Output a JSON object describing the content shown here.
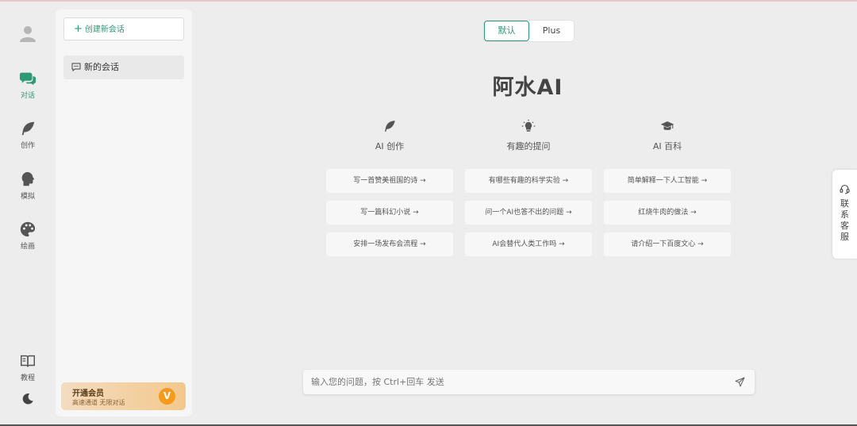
{
  "nav": {
    "items": [
      {
        "label": "对话",
        "icon": "chat-icon",
        "active": true
      },
      {
        "label": "创作",
        "icon": "feather-icon"
      },
      {
        "label": "模拟",
        "icon": "head-icon"
      },
      {
        "label": "绘画",
        "icon": "palette-icon"
      }
    ],
    "tutorial": {
      "label": "教程",
      "icon": "book-icon"
    },
    "theme": {
      "icon": "moon-icon"
    }
  },
  "sidebar": {
    "new_chat": "创建新会话",
    "sessions": [
      {
        "title": "新的会话"
      }
    ],
    "vip": {
      "title": "开通会员",
      "subtitle": "高速通道 无限对话",
      "badge": "V"
    }
  },
  "mode": {
    "options": [
      "默认",
      "Plus"
    ],
    "selected": "默认"
  },
  "brand": "阿水AI",
  "categories": [
    {
      "label": "AI 创作",
      "icon": "feather-icon",
      "prompts": [
        "写一首赞美祖国的诗 →",
        "写一篇科幻小说 →",
        "安排一场发布会流程 →"
      ]
    },
    {
      "label": "有趣的提问",
      "icon": "lightbulb-icon",
      "prompts": [
        "有哪些有趣的科学实验 →",
        "问一个AI也答不出的问题 →",
        "AI会替代人类工作吗 →"
      ]
    },
    {
      "label": "AI 百科",
      "icon": "graduation-cap-icon",
      "prompts": [
        "简单解释一下人工智能 →",
        "红烧牛肉的做法 →",
        "请介绍一下百度文心 →"
      ]
    }
  ],
  "input": {
    "placeholder": "输入您的问题，按 Ctrl+回车 发送",
    "value": ""
  },
  "contact": {
    "chars": [
      "联",
      "系",
      "客",
      "服"
    ]
  },
  "colors": {
    "accent": "#2b9a75",
    "vip_badge": "#f59a1b"
  }
}
